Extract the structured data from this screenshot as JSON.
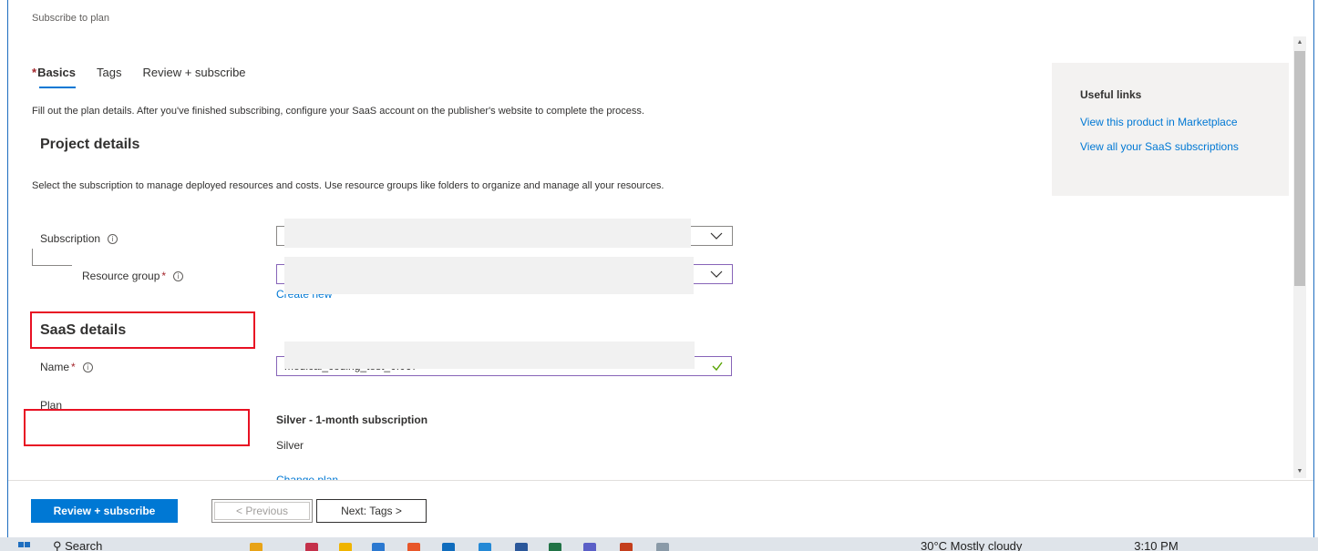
{
  "header": {
    "subtitle": "Subscribe to plan"
  },
  "tabs": [
    {
      "label": "Basics",
      "required_marker": "*",
      "active": true
    },
    {
      "label": "Tags",
      "active": false
    },
    {
      "label": "Review + subscribe",
      "active": false
    }
  ],
  "intro": "Fill out the plan details. After you've finished subscribing, configure your SaaS account on the publisher's website to complete the process.",
  "project": {
    "title": "Project details",
    "description": "Select the subscription to manage deployed resources and costs. Use resource groups like folders to organize and manage all your resources.",
    "subscription_label": "Subscription",
    "resource_group_label": "Resource group",
    "required_marker": "*",
    "create_new": "Create new"
  },
  "saas": {
    "title": "SaaS details",
    "name_label": "Name",
    "name_value": "medical_coding_test_0f067",
    "plan_label": "Plan",
    "plan_name": "Silver - 1-month subscription",
    "plan_tier": "Silver",
    "change_plan": "Change plan"
  },
  "useful_links": {
    "title": "Useful links",
    "links": [
      "View this product in Marketplace",
      "View all your SaaS subscriptions"
    ]
  },
  "footer": {
    "primary": "Review + subscribe",
    "previous": "< Previous",
    "next": "Next: Tags >"
  },
  "taskbar": {
    "search": "Search",
    "tray": "30°C  Mostly cloudy",
    "clock": "3:10 PM"
  },
  "colors": {
    "accent": "#0078d4",
    "required": "#a4262c",
    "highlight_box": "#e81123",
    "focus_border": "#8764b8",
    "valid_check": "#57a300"
  }
}
